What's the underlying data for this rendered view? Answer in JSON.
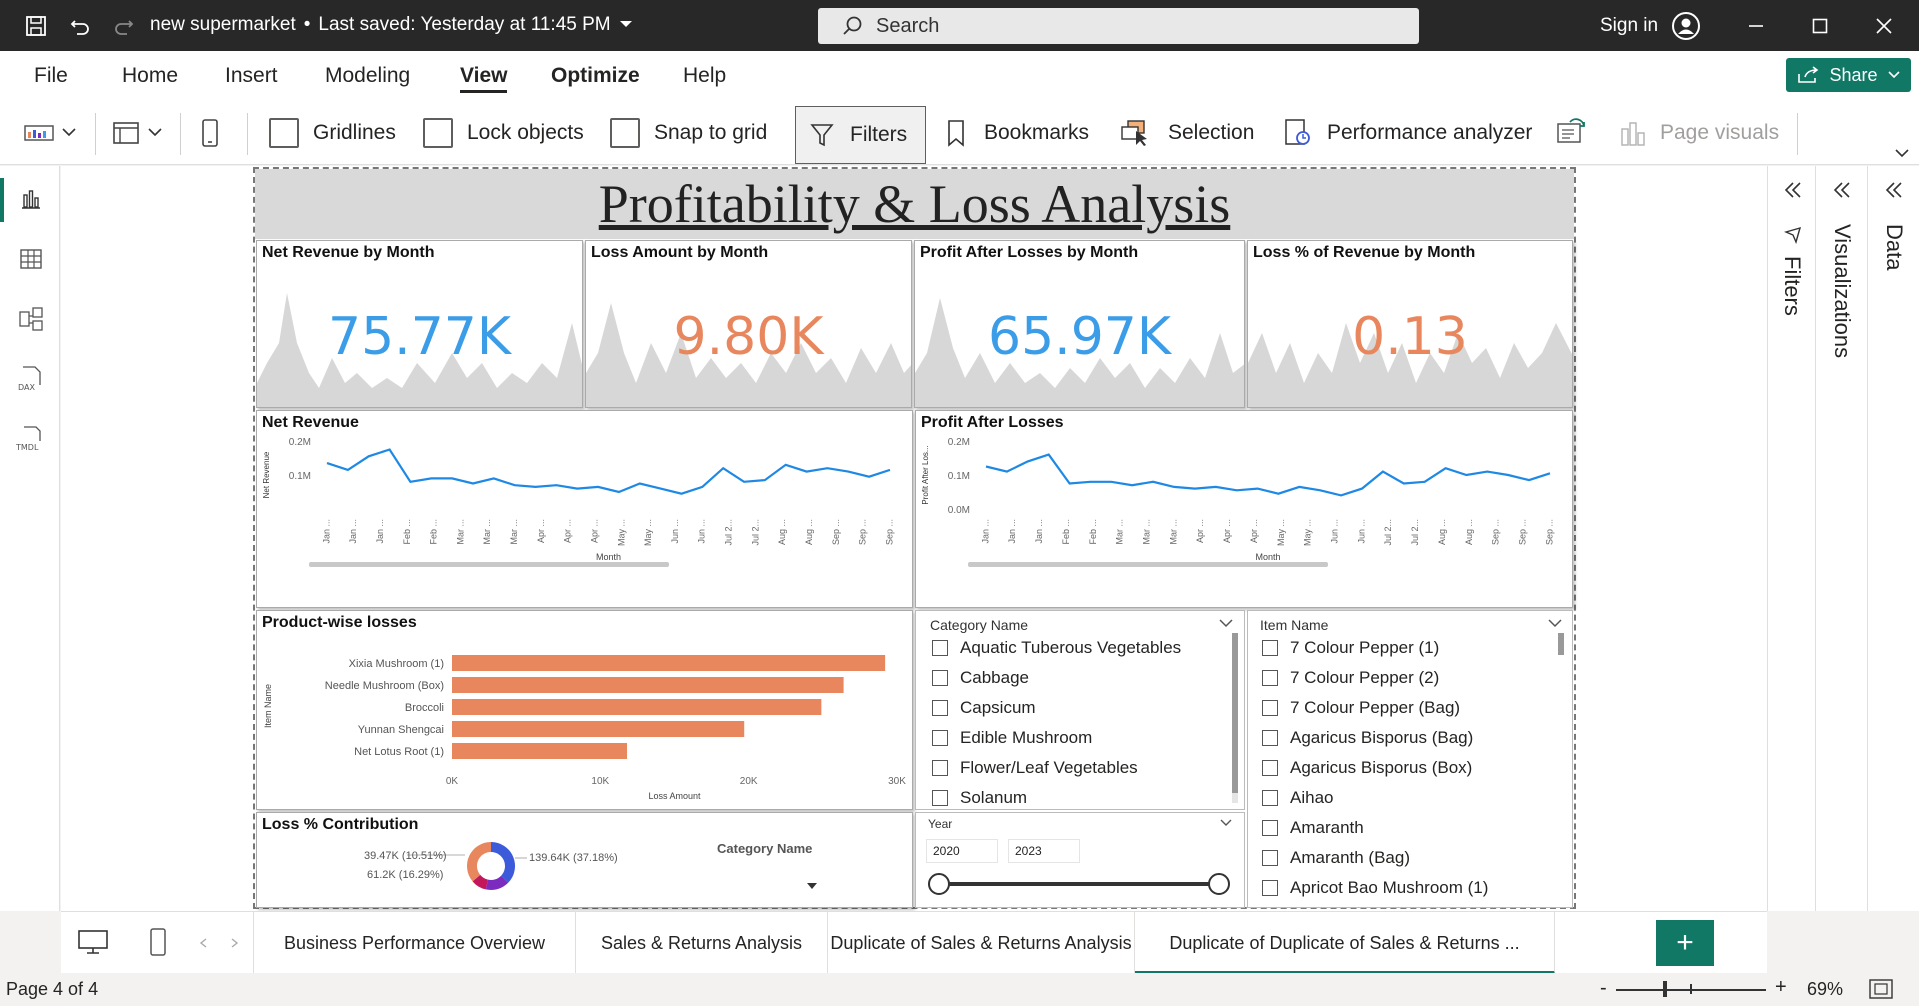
{
  "titlebar": {
    "doc_title": "new supermarket",
    "saved": "Last saved: Yesterday at 11:45 PM",
    "search_placeholder": "Search",
    "sign_in": "Sign in"
  },
  "menu": [
    "File",
    "Home",
    "Insert",
    "Modeling",
    "View",
    "Optimize",
    "Help"
  ],
  "share_label": "Share",
  "ribbon": {
    "gridlines": "Gridlines",
    "lock_objects": "Lock objects",
    "snap_to_grid": "Snap to grid",
    "filters": "Filters",
    "bookmarks": "Bookmarks",
    "selection": "Selection",
    "performance_analyzer": "Performance analyzer",
    "page_visuals": "Page visuals"
  },
  "report": {
    "title": "Profitability & Loss Analysis",
    "kpis": [
      {
        "title": "Net Revenue by Month",
        "value": "75.77K",
        "color": "#3b9ce8"
      },
      {
        "title": "Loss Amount by Month",
        "value": "9.80K",
        "color": "#e8875d"
      },
      {
        "title": "Profit After Losses by Month",
        "value": "65.97K",
        "color": "#3b9ce8"
      },
      {
        "title": "Loss % of Revenue by Month",
        "value": "0.13",
        "color": "#e8875d"
      }
    ],
    "month_ticks": [
      "Jan ...",
      "Jan ...",
      "Jan ...",
      "Feb ...",
      "Feb ...",
      "Mar ...",
      "Mar ...",
      "Mar ...",
      "Apr ...",
      "Apr ...",
      "Apr ...",
      "May ...",
      "May ...",
      "Jun ...",
      "Jun ...",
      "Jul 2...",
      "Jul 2...",
      "Aug ...",
      "Aug ...",
      "Sep ...",
      "Sep ...",
      "Sep ..."
    ],
    "pie": {
      "title": "Loss % Contribution",
      "labels": [
        "39.47K (10.51%)",
        "61.2K (16.29%)",
        "139.64K (37.18%)"
      ],
      "legend_title": "Category Name"
    },
    "category_slicer": {
      "header": "Category Name",
      "items": [
        "Aquatic Tuberous Vegetables",
        "Cabbage",
        "Capsicum",
        "Edible Mushroom",
        "Flower/Leaf Vegetables",
        "Solanum"
      ]
    },
    "item_slicer": {
      "header": "Item Name",
      "items": [
        "7 Colour Pepper (1)",
        "7 Colour Pepper (2)",
        "7 Colour Pepper (Bag)",
        "Agaricus Bisporus (Bag)",
        "Agaricus Bisporus (Box)",
        "Aihao",
        "Amaranth",
        "Amaranth (Bag)",
        "Apricot Bao Mushroom (1)"
      ]
    },
    "year_slicer": {
      "header": "Year",
      "from": "2020",
      "to": "2023"
    }
  },
  "chart_data": [
    {
      "type": "line",
      "title": "Net Revenue",
      "xlabel": "Month",
      "ylabel": "Net Revenue",
      "yticks": [
        "0.1M",
        "0.2M"
      ],
      "ylim": [
        0,
        0.2
      ],
      "x_count": 28,
      "series": [
        {
          "values": [
            0.135,
            0.115,
            0.155,
            0.175,
            0.08,
            0.09,
            0.09,
            0.075,
            0.09,
            0.07,
            0.065,
            0.07,
            0.06,
            0.065,
            0.05,
            0.075,
            0.06,
            0.045,
            0.065,
            0.12,
            0.08,
            0.085,
            0.13,
            0.11,
            0.12,
            0.11,
            0.095,
            0.115
          ]
        }
      ]
    },
    {
      "type": "line",
      "title": "Profit After Losses",
      "xlabel": "Month",
      "ylabel": "Profit After Los...",
      "yticks": [
        "0.0M",
        "0.1M",
        "0.2M"
      ],
      "ylim": [
        0,
        0.2
      ],
      "x_count": 28,
      "series": [
        {
          "values": [
            0.125,
            0.11,
            0.14,
            0.16,
            0.075,
            0.08,
            0.08,
            0.07,
            0.08,
            0.065,
            0.06,
            0.065,
            0.055,
            0.06,
            0.045,
            0.065,
            0.055,
            0.04,
            0.06,
            0.11,
            0.075,
            0.08,
            0.12,
            0.1,
            0.11,
            0.1,
            0.085,
            0.105
          ]
        }
      ]
    },
    {
      "type": "bar",
      "title": "Product-wise losses",
      "xlabel": "Loss Amount",
      "ylabel": "Item Name",
      "categories": [
        "Xixia Mushroom (1)",
        "Needle Mushroom (Box)",
        "Broccoli",
        "Yunnan Shengcai",
        "Net Lotus Root (1)"
      ],
      "values": [
        29200,
        26400,
        24900,
        19700,
        11800
      ],
      "xticks": [
        "0K",
        "10K",
        "20K",
        "30K"
      ],
      "xlim": [
        0,
        30000
      ],
      "color": "#e8875d"
    },
    {
      "type": "pie",
      "title": "Loss % Contribution",
      "values": [
        37.18,
        16.29,
        10.51,
        36.02
      ],
      "colors": [
        "#3b5bdb",
        "#7b2cbf",
        "#c2185b",
        "#e8875d"
      ]
    }
  ],
  "pages": [
    "Business Performance Overview",
    "Sales & Returns Analysis",
    "Duplicate of Sales & Returns Analysis",
    "Duplicate of Duplicate of Sales & Returns ..."
  ],
  "right_panels": {
    "filters": "Filters",
    "visualizations": "Visualizations",
    "data": "Data"
  },
  "status": {
    "page": "Page 4 of 4",
    "zoom": "69%"
  }
}
